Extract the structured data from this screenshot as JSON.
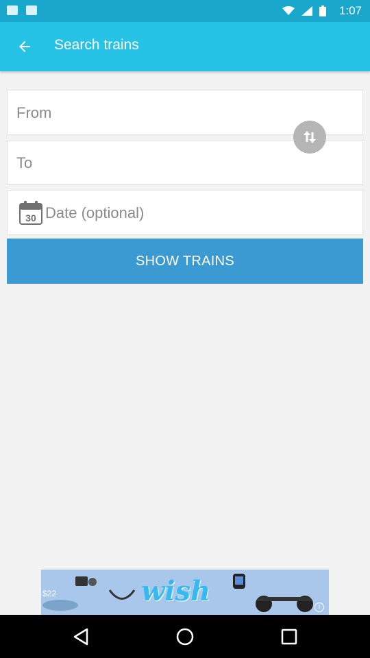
{
  "status_bar": {
    "time": "1:07"
  },
  "app_bar": {
    "title": "Search trains",
    "back_icon": "arrow-back-icon"
  },
  "form": {
    "from_placeholder": "From",
    "to_placeholder": "To",
    "date_placeholder": "Date (optional)",
    "calendar_day": "30",
    "swap_icon": "swap-vertical-icon",
    "submit_label": "SHOW TRAINS"
  },
  "ad": {
    "brand": "wish",
    "price": "$22"
  },
  "colors": {
    "status_bar": "#1aa7cc",
    "app_bar": "#27c3e6",
    "button": "#3a9ad1",
    "background": "#f2f2f2"
  }
}
